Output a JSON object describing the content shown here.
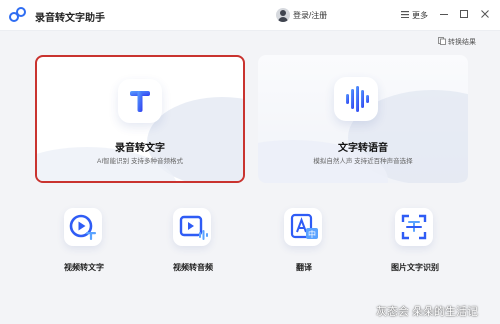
{
  "app": {
    "title": "录音转文字助手"
  },
  "header": {
    "login_label": "登录/注册",
    "more_label": "更多"
  },
  "toolbar": {
    "switch_result_label": "转换结果"
  },
  "cards": [
    {
      "title": "录音转文字",
      "subtitle": "AI智能识别 支持多种音频格式",
      "selected": true,
      "accent": "#2f5cf5"
    },
    {
      "title": "文字转语音",
      "subtitle": "模拟自然人声 支持近百种声音选择",
      "selected": false,
      "accent": "#2f5cf5"
    }
  ],
  "tools": [
    {
      "label": "视频转文字",
      "icon": "video-to-text-icon"
    },
    {
      "label": "视频转音频",
      "icon": "video-to-audio-icon"
    },
    {
      "label": "翻译",
      "icon": "translate-icon"
    },
    {
      "label": "图片文字识别",
      "icon": "image-ocr-icon"
    }
  ],
  "watermark": "灰态会 朵朵的生活记",
  "colors": {
    "accent": "#2f5cf5",
    "accent_light": "#5aa3ff",
    "selection_border": "#c9332f"
  }
}
